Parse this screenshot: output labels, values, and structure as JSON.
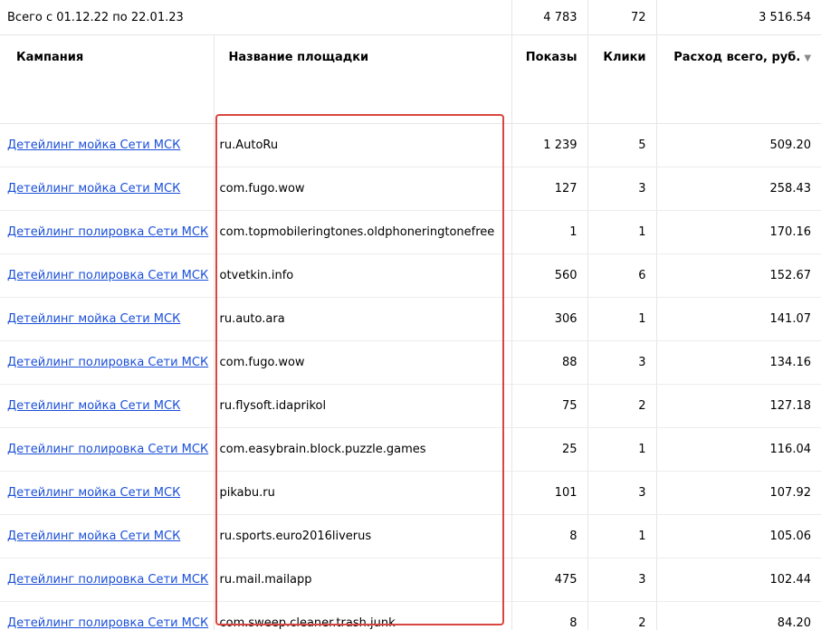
{
  "totals": {
    "label": "Всего с 01.12.22 по 22.01.23",
    "shows": "4 783",
    "clicks": "72",
    "cost": "3 516.54"
  },
  "columns": {
    "campaign": "Кампания",
    "site": "Название площадки",
    "shows": "Показы",
    "clicks": "Клики",
    "cost": "Расход всего, руб."
  },
  "sort_indicator": "▼",
  "accent_colors": {
    "link": "#1a4fd8",
    "highlight_border": "#d9463f"
  },
  "rows": [
    {
      "campaign": "Детейлинг мойка Сети МСК",
      "site": "ru.AutoRu",
      "shows": "1 239",
      "clicks": "5",
      "cost": "509.20"
    },
    {
      "campaign": "Детейлинг мойка Сети МСК",
      "site": "com.fugo.wow",
      "shows": "127",
      "clicks": "3",
      "cost": "258.43"
    },
    {
      "campaign": "Детейлинг полировка Сети МСК",
      "site": "com.topmobileringtones.oldphoneringtonefree",
      "shows": "1",
      "clicks": "1",
      "cost": "170.16"
    },
    {
      "campaign": "Детейлинг полировка Сети МСК",
      "site": "otvetkin.info",
      "shows": "560",
      "clicks": "6",
      "cost": "152.67"
    },
    {
      "campaign": "Детейлинг мойка Сети МСК",
      "site": "ru.auto.ara",
      "shows": "306",
      "clicks": "1",
      "cost": "141.07"
    },
    {
      "campaign": "Детейлинг полировка Сети МСК",
      "site": "com.fugo.wow",
      "shows": "88",
      "clicks": "3",
      "cost": "134.16"
    },
    {
      "campaign": "Детейлинг мойка Сети МСК",
      "site": "ru.flysoft.idaprikol",
      "shows": "75",
      "clicks": "2",
      "cost": "127.18"
    },
    {
      "campaign": "Детейлинг полировка Сети МСК",
      "site": "com.easybrain.block.puzzle.games",
      "shows": "25",
      "clicks": "1",
      "cost": "116.04"
    },
    {
      "campaign": "Детейлинг мойка Сети МСК",
      "site": "pikabu.ru",
      "shows": "101",
      "clicks": "3",
      "cost": "107.92"
    },
    {
      "campaign": "Детейлинг мойка Сети МСК",
      "site": "ru.sports.euro2016liverus",
      "shows": "8",
      "clicks": "1",
      "cost": "105.06"
    },
    {
      "campaign": "Детейлинг полировка Сети МСК",
      "site": "ru.mail.mailapp",
      "shows": "475",
      "clicks": "3",
      "cost": "102.44"
    },
    {
      "campaign": "Детейлинг полировка Сети МСК",
      "site": "com.sweep.cleaner.trash.junk",
      "shows": "8",
      "clicks": "2",
      "cost": "84.20"
    }
  ]
}
